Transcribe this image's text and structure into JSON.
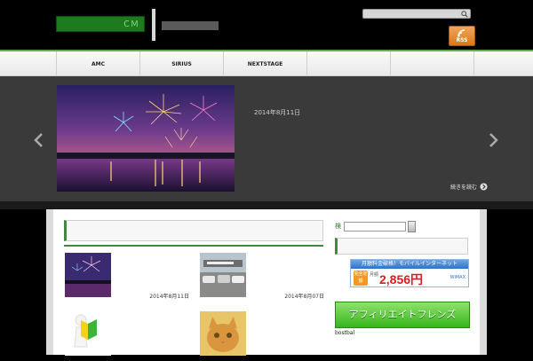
{
  "header": {
    "logo_text": "ＣＭ",
    "search_placeholder": "",
    "rss_label": "RSS"
  },
  "nav": {
    "items": [
      "AMC",
      "SIRIUS",
      "NEXTSTAGE",
      "",
      ""
    ]
  },
  "slider": {
    "title": "",
    "date": "2014年8月11日",
    "text": "",
    "more_label": "続きを読む"
  },
  "content": {
    "section_title": "",
    "posts": [
      {
        "title": "",
        "date": "2014年8月11日"
      },
      {
        "title": "",
        "date": "2014年8月07日"
      },
      {
        "title": "",
        "date": ""
      },
      {
        "title": "",
        "date": ""
      }
    ]
  },
  "sidebar": {
    "search_label": "検",
    "search_value": "",
    "banner_head": "",
    "banner1": {
      "top_text": "月額料金破格！モバイルインターネット",
      "badge": "完全定額",
      "mini": "月額",
      "price": "2,856円",
      "brand": "WiMAX"
    },
    "banner2_text": "アフィリエイトフレンズ",
    "footer_text": "bostbal"
  },
  "colors": {
    "accent_green": "#3e8a3e",
    "rss_orange": "#e08a2c",
    "slider_bg": "#3a3a3a"
  }
}
